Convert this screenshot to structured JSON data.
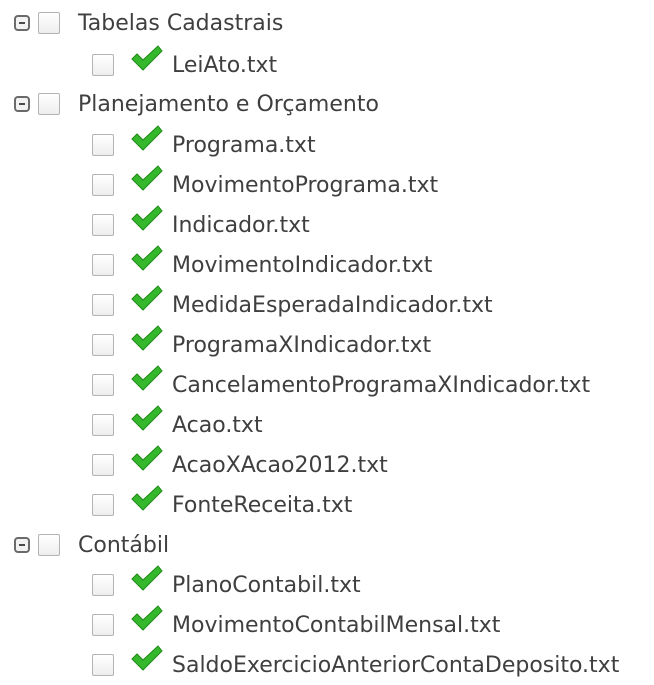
{
  "tree": {
    "groups": [
      {
        "label": "Tabelas Cadastrais",
        "files": [
          "LeiAto.txt"
        ]
      },
      {
        "label": "Planejamento e Orçamento",
        "files": [
          "Programa.txt",
          "MovimentoPrograma.txt",
          "Indicador.txt",
          "MovimentoIndicador.txt",
          "MedidaEsperadaIndicador.txt",
          "ProgramaXIndicador.txt",
          "CancelamentoProgramaXIndicador.txt",
          "Acao.txt",
          "AcaoXAcao2012.txt",
          "FonteReceita.txt"
        ]
      },
      {
        "label": "Contábil",
        "files": [
          "PlanoContabil.txt",
          "MovimentoContabilMensal.txt",
          "SaldoExercicioAnteriorContaDeposito.txt"
        ]
      }
    ]
  },
  "icons": {
    "toggle": "collapse-minus-icon",
    "checkbox": "checkbox-unchecked",
    "status": "green-checkmark-icon"
  },
  "colors": {
    "check_green": "#35b82c",
    "text": "#3f3f3f"
  }
}
